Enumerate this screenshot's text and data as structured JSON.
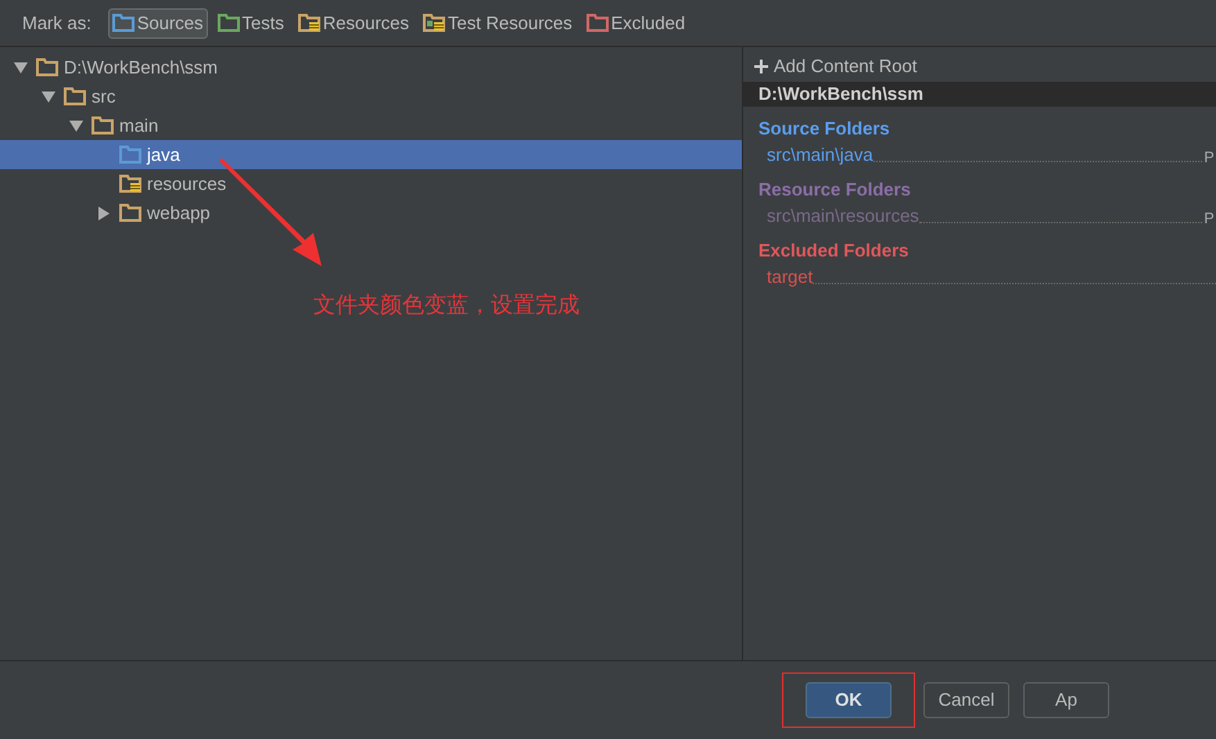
{
  "mark_as": {
    "label": "Mark as:",
    "options": [
      {
        "label": "Sources",
        "kind": "source",
        "selected": true
      },
      {
        "label": "Tests",
        "kind": "test",
        "selected": false
      },
      {
        "label": "Resources",
        "kind": "resource",
        "selected": false
      },
      {
        "label": "Test Resources",
        "kind": "test_resource",
        "selected": false
      },
      {
        "label": "Excluded",
        "kind": "excluded",
        "selected": false
      }
    ]
  },
  "tree": [
    {
      "label": "D:\\WorkBench\\ssm",
      "kind": "folder",
      "expanded": true,
      "selected": false,
      "children": [
        {
          "label": "src",
          "kind": "folder",
          "expanded": true,
          "selected": false,
          "children": [
            {
              "label": "main",
              "kind": "folder",
              "expanded": true,
              "selected": false,
              "children": [
                {
                  "label": "java",
                  "kind": "source",
                  "selected": true
                },
                {
                  "label": "resources",
                  "kind": "resource",
                  "selected": false
                },
                {
                  "label": "webapp",
                  "kind": "folder",
                  "expanded": false,
                  "selected": false
                }
              ]
            }
          ]
        }
      ]
    }
  ],
  "annotation": {
    "text": "文件夹颜色变蓝，设置完成"
  },
  "content_root": {
    "add_label": "Add Content Root",
    "path": "D:\\WorkBench\\ssm",
    "sections": [
      {
        "title": "Source Folders",
        "kind": "source",
        "folders": [
          {
            "path": "src\\main\\java",
            "action": "P"
          }
        ]
      },
      {
        "title": "Resource Folders",
        "kind": "resource",
        "folders": [
          {
            "path": "src\\main\\resources",
            "action": "P"
          }
        ]
      },
      {
        "title": "Excluded Folders",
        "kind": "excluded",
        "folders": [
          {
            "path": "target"
          }
        ]
      }
    ]
  },
  "buttons": [
    {
      "label": "OK",
      "default": true
    },
    {
      "label": "Cancel",
      "default": false
    },
    {
      "label": "Ap",
      "default": false
    }
  ]
}
